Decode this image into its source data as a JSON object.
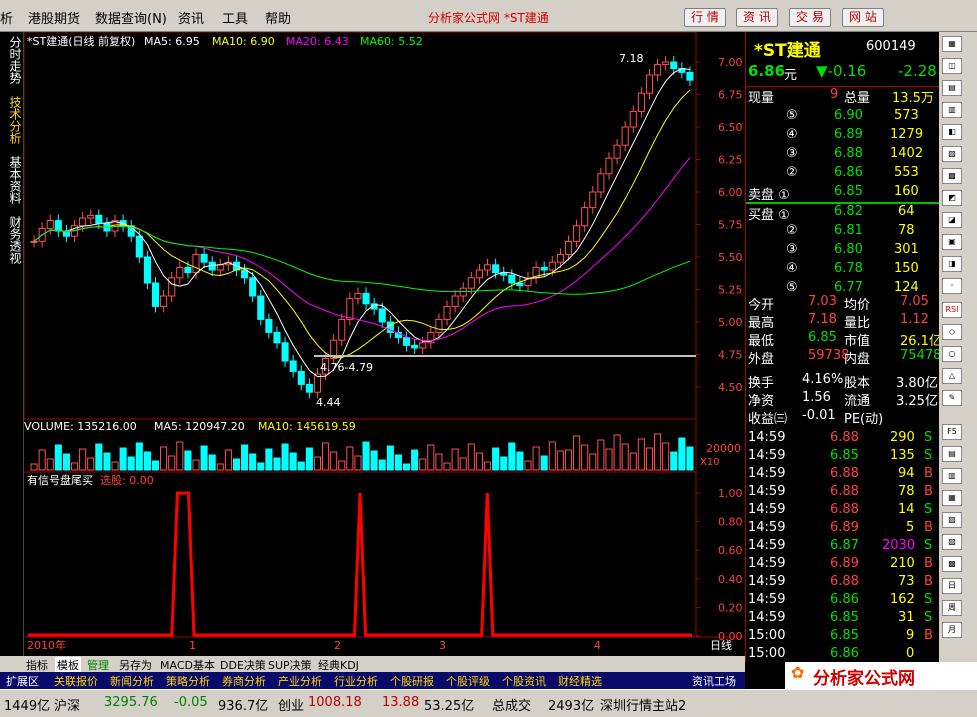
{
  "menu": {
    "items": [
      "析",
      "港股期货",
      "数据查询(N)",
      "资讯",
      "工具",
      "帮助"
    ],
    "center_title": "分析家公式网 *ST建通",
    "toolbar_buttons": [
      "行 情",
      "资 讯",
      "交 易",
      "网 站"
    ]
  },
  "left_tabs": [
    "分时走势",
    "技术分析",
    "基本资料",
    "财务透视"
  ],
  "chart": {
    "title": "*ST建通(日线 前复权)",
    "ma_legend": [
      {
        "label": "MA5: 6.95",
        "color": "#ffffff"
      },
      {
        "label": "MA10: 6.90",
        "color": "#ffff00"
      },
      {
        "label": "MA20: 6.43",
        "color": "#ff00ff"
      },
      {
        "label": "MA60: 5.52",
        "color": "#00ff00"
      }
    ],
    "price_ticks": [
      "7.00",
      "6.75",
      "6.50",
      "6.25",
      "6.00",
      "5.75",
      "5.50",
      "5.25",
      "5.00",
      "4.75",
      "4.50"
    ],
    "annotations": {
      "high": "7.18",
      "low": "4.44",
      "range": "4.76-4.79"
    },
    "volume_legend": [
      "VOLUME: 135216.00",
      "MA5: 120947.20",
      "MA10: 145619.59"
    ],
    "volume_tick": "20000",
    "volume_unit": "X10",
    "indicator_title": "有信号盘尾买",
    "indicator_select": "选股: 0.00",
    "indicator_ticks": [
      "1.00",
      "0.80",
      "0.60",
      "0.40",
      "0.20",
      "0.00"
    ],
    "date_labels": [
      "2010年",
      "1",
      "2",
      "3",
      "4"
    ],
    "period": "日线",
    "corner_buttons": [
      "+",
      "-",
      "□"
    ]
  },
  "chart_data": {
    "type": "line",
    "series": [
      {
        "name": "有信号盘尾买",
        "values": [
          0,
          0,
          0,
          0,
          0,
          0,
          0,
          0,
          0,
          0,
          0,
          0,
          0,
          0,
          0,
          0,
          0,
          0,
          0,
          0,
          0,
          0,
          0,
          0,
          0,
          0,
          0,
          1,
          1,
          1,
          0,
          0,
          0,
          0,
          0,
          0,
          0,
          0,
          0,
          0,
          0,
          0,
          0,
          0,
          0,
          0,
          0,
          0,
          0,
          0,
          0,
          0,
          0,
          0,
          0,
          0,
          0,
          0,
          0,
          0,
          1,
          0,
          0,
          0,
          0,
          0,
          0,
          0,
          0,
          0,
          0,
          0,
          0,
          0,
          0,
          0,
          0,
          0,
          0,
          0,
          0,
          0,
          0,
          1,
          0,
          0,
          0,
          0,
          0,
          0,
          0,
          0,
          0,
          0,
          0,
          0,
          0,
          0,
          0,
          0,
          0,
          0,
          0,
          0,
          0,
          0,
          0,
          0,
          0,
          0,
          0,
          0,
          0,
          0,
          0,
          0,
          0,
          0,
          0,
          0,
          0
        ]
      }
    ],
    "ylim": [
      0,
      1
    ]
  },
  "quote": {
    "name": "*ST建通",
    "code": "600149",
    "price": "6.86",
    "unit": "元",
    "change": "▼-0.16",
    "pct": "-2.28",
    "now_label": "现量",
    "now_val": "9",
    "total_label": "总量",
    "total_val": "13.5万",
    "asks": [
      {
        "lv": "⑤",
        "p": "6.90",
        "v": "573"
      },
      {
        "lv": "④",
        "p": "6.89",
        "v": "1279"
      },
      {
        "lv": "③",
        "p": "6.88",
        "v": "1402"
      },
      {
        "lv": "②",
        "p": "6.86",
        "v": "553"
      },
      {
        "lv": "卖盘 ①",
        "p": "6.85",
        "v": "160"
      }
    ],
    "bids": [
      {
        "lv": "买盘 ①",
        "p": "6.82",
        "v": "64"
      },
      {
        "lv": "②",
        "p": "6.81",
        "v": "78"
      },
      {
        "lv": "③",
        "p": "6.80",
        "v": "301"
      },
      {
        "lv": "④",
        "p": "6.78",
        "v": "150"
      },
      {
        "lv": "⑤",
        "p": "6.77",
        "v": "124"
      }
    ],
    "stats": [
      {
        "l1": "今开",
        "v1": "7.03",
        "l2": "均价",
        "v2": "7.05"
      },
      {
        "l1": "最高",
        "v1": "7.18",
        "l2": "量比",
        "v2": "1.12"
      },
      {
        "l1": "最低",
        "v1": "6.85",
        "l2": "市值",
        "v2": "26.1亿"
      },
      {
        "l1": "外盘",
        "v1": "59738",
        "l2": "内盘",
        "v2": "75478"
      }
    ],
    "stats2": [
      {
        "l1": "换手",
        "v1": "4.16%",
        "l2": "股本",
        "v2": "3.80亿"
      },
      {
        "l1": "净资",
        "v1": "1.56",
        "l2": "流通",
        "v2": "3.25亿"
      },
      {
        "l1": "收益㈢",
        "v1": "-0.01",
        "l2": "PE(动)",
        "v2": ""
      }
    ],
    "ticks": [
      {
        "t": "14:59",
        "p": "6.88",
        "v": "290",
        "s": "S"
      },
      {
        "t": "14:59",
        "p": "6.85",
        "v": "135",
        "s": "S"
      },
      {
        "t": "14:59",
        "p": "6.88",
        "v": "94",
        "s": "B"
      },
      {
        "t": "14:59",
        "p": "6.88",
        "v": "78",
        "s": "B"
      },
      {
        "t": "14:59",
        "p": "6.88",
        "v": "14",
        "s": "S"
      },
      {
        "t": "14:59",
        "p": "6.89",
        "v": "5",
        "s": "B"
      },
      {
        "t": "14:59",
        "p": "6.87",
        "v": "2030",
        "s": "S"
      },
      {
        "t": "14:59",
        "p": "6.89",
        "v": "210",
        "s": "B"
      },
      {
        "t": "14:59",
        "p": "6.88",
        "v": "73",
        "s": "B"
      },
      {
        "t": "14:59",
        "p": "6.86",
        "v": "162",
        "s": "S"
      },
      {
        "t": "14:59",
        "p": "6.85",
        "v": "31",
        "s": "S"
      },
      {
        "t": "15:00",
        "p": "6.85",
        "v": "9",
        "s": "B"
      },
      {
        "t": "15:00",
        "p": "6.86",
        "v": "0",
        "s": ""
      }
    ]
  },
  "right_icons": [
    "F1",
    "F2",
    "F5",
    "日",
    "周",
    "月",
    "笔"
  ],
  "bottom_tabs": [
    "指标",
    "模板",
    "管理",
    "另存为",
    "MACD基本",
    "DDE决策",
    "SUP决策",
    "经典KDJ"
  ],
  "bottom_tabs2": [
    "扩展区",
    "关联报价",
    "新闻分析",
    "策略分析",
    "券商分析",
    "产业分析",
    "行业分析",
    "个股研报",
    "个股评级",
    "个股资讯",
    "财经精选",
    "资讯工场"
  ],
  "status": [
    {
      "label": "1449亿",
      "color": "#000"
    },
    {
      "label": "沪深",
      "color": "#000"
    },
    {
      "label": "3295.76",
      "color": "#008000"
    },
    {
      "label": "-0.05",
      "color": "#008000"
    },
    {
      "label": "936.7亿",
      "color": "#000"
    },
    {
      "label": "创业",
      "color": "#000"
    },
    {
      "label": "1008.18",
      "color": "#c00000"
    },
    {
      "label": "13.88",
      "color": "#c00000"
    },
    {
      "label": "53.25亿",
      "color": "#000"
    },
    {
      "label": "总成交",
      "color": "#000"
    },
    {
      "label": "2493亿",
      "color": "#000"
    },
    {
      "label": "深圳行情主站2",
      "color": "#000"
    }
  ],
  "logo": {
    "text": "分析家公式网",
    "url": "www.88gs.com"
  }
}
